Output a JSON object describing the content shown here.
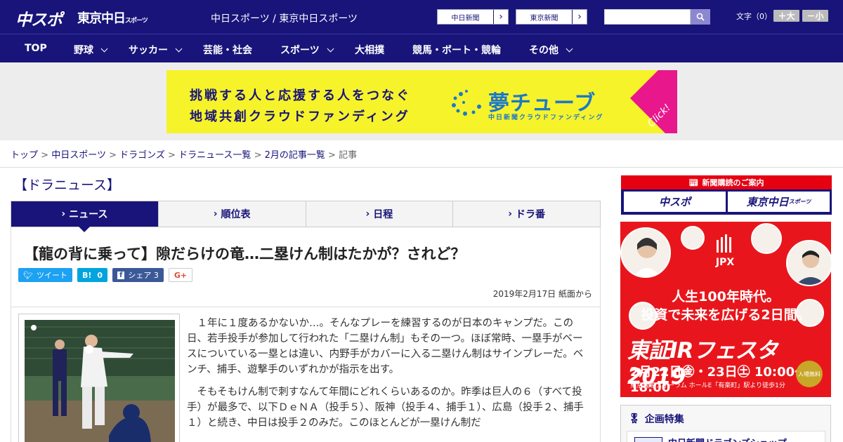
{
  "header": {
    "logo_main": "中スポ",
    "logo_sub": "東京中日",
    "logo_sub_small": "スポーツ",
    "site_name": "中日スポーツ / 東京中日スポーツ",
    "ext_links": [
      "中日新聞",
      "東京新聞"
    ],
    "ext_arrow": "›",
    "search_placeholder": "",
    "font_size_label": "文字（0）",
    "font_larger": "＋大",
    "font_smaller": "－小"
  },
  "nav": {
    "items": [
      {
        "label": "TOP",
        "has_dropdown": false
      },
      {
        "label": "野球",
        "has_dropdown": true
      },
      {
        "label": "サッカー",
        "has_dropdown": true
      },
      {
        "label": "芸能・社会",
        "has_dropdown": false
      },
      {
        "label": "スポーツ",
        "has_dropdown": true
      },
      {
        "label": "大相撲",
        "has_dropdown": false
      },
      {
        "label": "競馬・ボート・競輪",
        "has_dropdown": false
      },
      {
        "label": "その他",
        "has_dropdown": true
      }
    ]
  },
  "banner": {
    "line1": "挑戦する人と応援する人をつなぐ",
    "line2": "地域共創クラウドファンディング",
    "brand": "夢チューブ",
    "brand_sub": "中日新聞クラウドファンディング",
    "cta": "Click!",
    "colors": {
      "bg": "#f6f32b",
      "accent": "#e8178c",
      "brand": "#1e78c8"
    }
  },
  "breadcrumb": {
    "links": [
      "トップ",
      "中日スポーツ",
      "ドラゴンズ",
      "ドラニュース一覧",
      "2月の記事一覧"
    ],
    "separator": ">",
    "current": "記事"
  },
  "section_title": "【ドラニュース】",
  "tabs": [
    {
      "label": "ニュース",
      "active": true
    },
    {
      "label": "順位表",
      "active": false
    },
    {
      "label": "日程",
      "active": false
    },
    {
      "label": "ドラ番",
      "active": false
    }
  ],
  "article": {
    "title": "【龍の背に乗って】隙だらけの竜…二塁けん制はたかが？されど？",
    "share": {
      "tweet": "ツイート",
      "hatena_icon": "B!",
      "hatena_count": "0",
      "facebook": "シェア",
      "facebook_count": "3",
      "gplus": "G+"
    },
    "date": "2019年2月17日 紙面から",
    "paragraphs": [
      "１年に１度あるかないか…。そんなプレーを練習するのが日本のキャンプだ。この日、若手投手が参加して行われた「二塁けん制」もその一つ。ほぼ常時、一塁手がベースについている一塁とは違い、内野手がカバーに入る二塁けん制はサインプレーだ。ベンチ、捕手、遊撃手のいずれかが指示を出す。",
      "そもそもけん制で刺すなんて年間にどれくらいあるのか。昨季は巨人の６（すべて投手）が最多で、以下ＤｅＮＡ（投手５）、阪神（投手４、捕手１）、広島（投手２、捕手１）と続き、中日は投手２のみだ。このほとんどが一塁けん制だ"
    ]
  },
  "sidebar": {
    "subscribe": {
      "header": "新聞購読のご案内",
      "left": "中スポ",
      "right": "東京中日",
      "right_small": "スポーツ"
    },
    "ad": {
      "logo": "JPX",
      "line1": "人生100年時代。",
      "line2": "投資で未来を広げる2日間。",
      "event": "東証IRフェスタ2019",
      "dates": "2月22日㊎・23日㊏ 10:00～18:00",
      "venue": "東京国際フォーラム ホールE「有楽町」駅より徒歩1分",
      "badge": "入場無料"
    },
    "feature": {
      "title": "企画特集",
      "item": "中日新聞ドラゴンズショップ"
    }
  },
  "colors": {
    "primary": "#18147a",
    "red": "#e50012",
    "twitter": "#1da1f2",
    "hatena": "#00a4de",
    "facebook": "#3b5998"
  }
}
